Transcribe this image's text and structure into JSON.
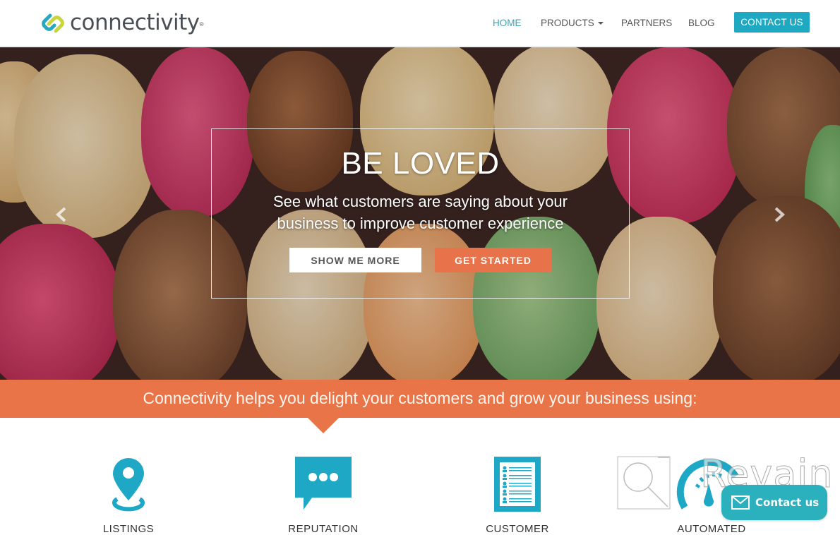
{
  "brand": {
    "name": "connectivity",
    "tm": "®",
    "accent": "#1ea8c1",
    "orange": "#e87447"
  },
  "nav": {
    "items": [
      {
        "label": "HOME",
        "active": true
      },
      {
        "label": "PRODUCTS",
        "has_dropdown": true
      },
      {
        "label": "PARTNERS"
      },
      {
        "label": "BLOG"
      }
    ],
    "cta": "CONTACT US"
  },
  "hero": {
    "title": "BE LOVED",
    "subtitle_line1": "See what customers are saying about your",
    "subtitle_line2": "business to improve customer experience",
    "primary_button": "SHOW ME MORE",
    "secondary_button": "GET STARTED",
    "prev_icon": "chevron-left-icon",
    "next_icon": "chevron-right-icon"
  },
  "band": {
    "text": "Connectivity helps you delight your customers and grow your business using:"
  },
  "features": [
    {
      "label": "LISTINGS",
      "icon": "map-pin-icon"
    },
    {
      "label": "REPUTATION",
      "icon": "chat-bubble-icon"
    },
    {
      "label": "CUSTOMER",
      "icon": "customer-list-icon"
    },
    {
      "label": "AUTOMATED",
      "icon": "gauge-icon"
    }
  ],
  "watermark": {
    "text": "Revain"
  },
  "contact_widget": {
    "label": "Contact us",
    "icon": "envelope-icon"
  }
}
